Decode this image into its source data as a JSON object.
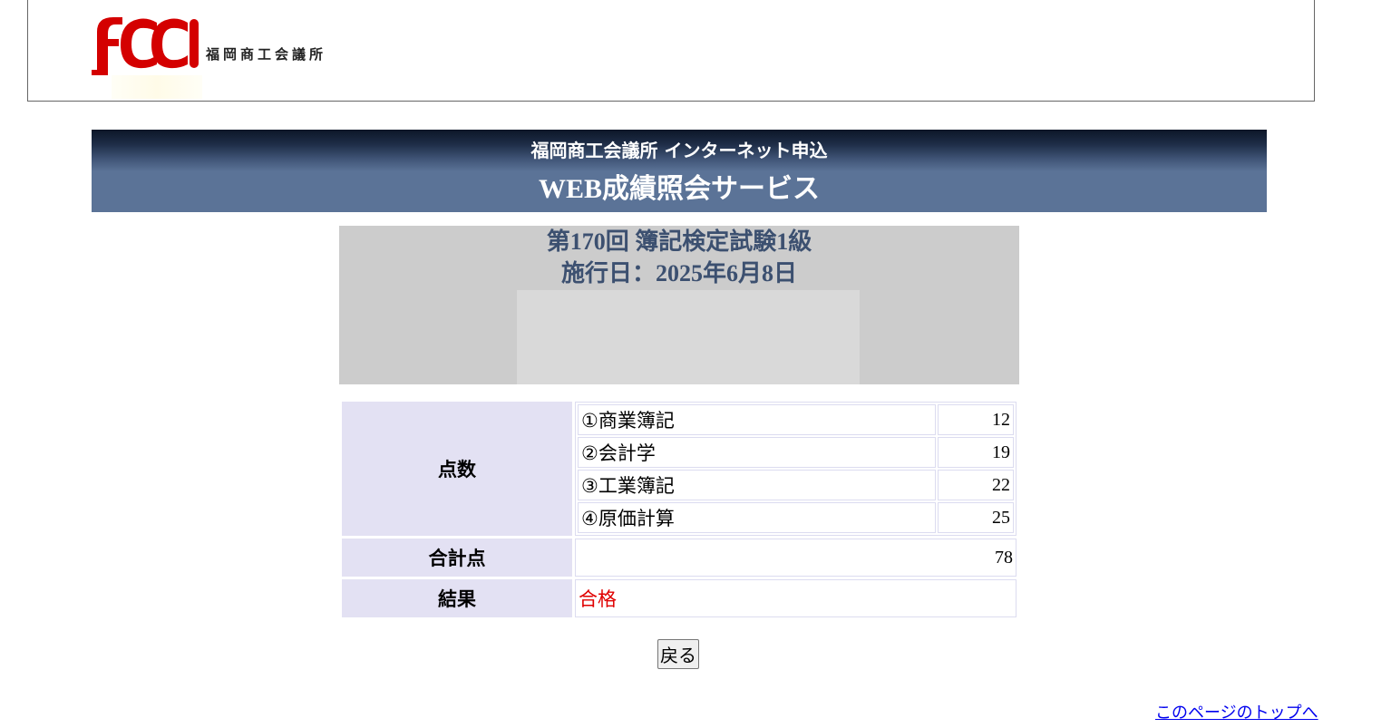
{
  "header": {
    "logo_text": "福岡商工会議所",
    "logo_icon": "fcci-logo-icon"
  },
  "banner": {
    "line1": "福岡商工会議所 インターネット申込",
    "line2": "WEB成績照会サービス"
  },
  "exam": {
    "title": "第170回 簿記検定試験1級",
    "date": "施行日：2025年6月8日"
  },
  "scores": {
    "score_label": "点数",
    "subjects": [
      {
        "name": "①商業簿記",
        "score": "12"
      },
      {
        "name": "②会計学",
        "score": "19"
      },
      {
        "name": "③工業簿記",
        "score": "22"
      },
      {
        "name": "④原価計算",
        "score": "25"
      }
    ],
    "total_label": "合計点",
    "total_value": "78",
    "result_label": "結果",
    "result_value": "合格"
  },
  "actions": {
    "back_label": "戻る",
    "top_link": "このページのトップへ"
  },
  "colors": {
    "banner": "#5b7397",
    "label_bg": "#e3e1f3",
    "exam_title": "#3c5070",
    "result": "#e00000",
    "logo_red": "#d40000"
  }
}
